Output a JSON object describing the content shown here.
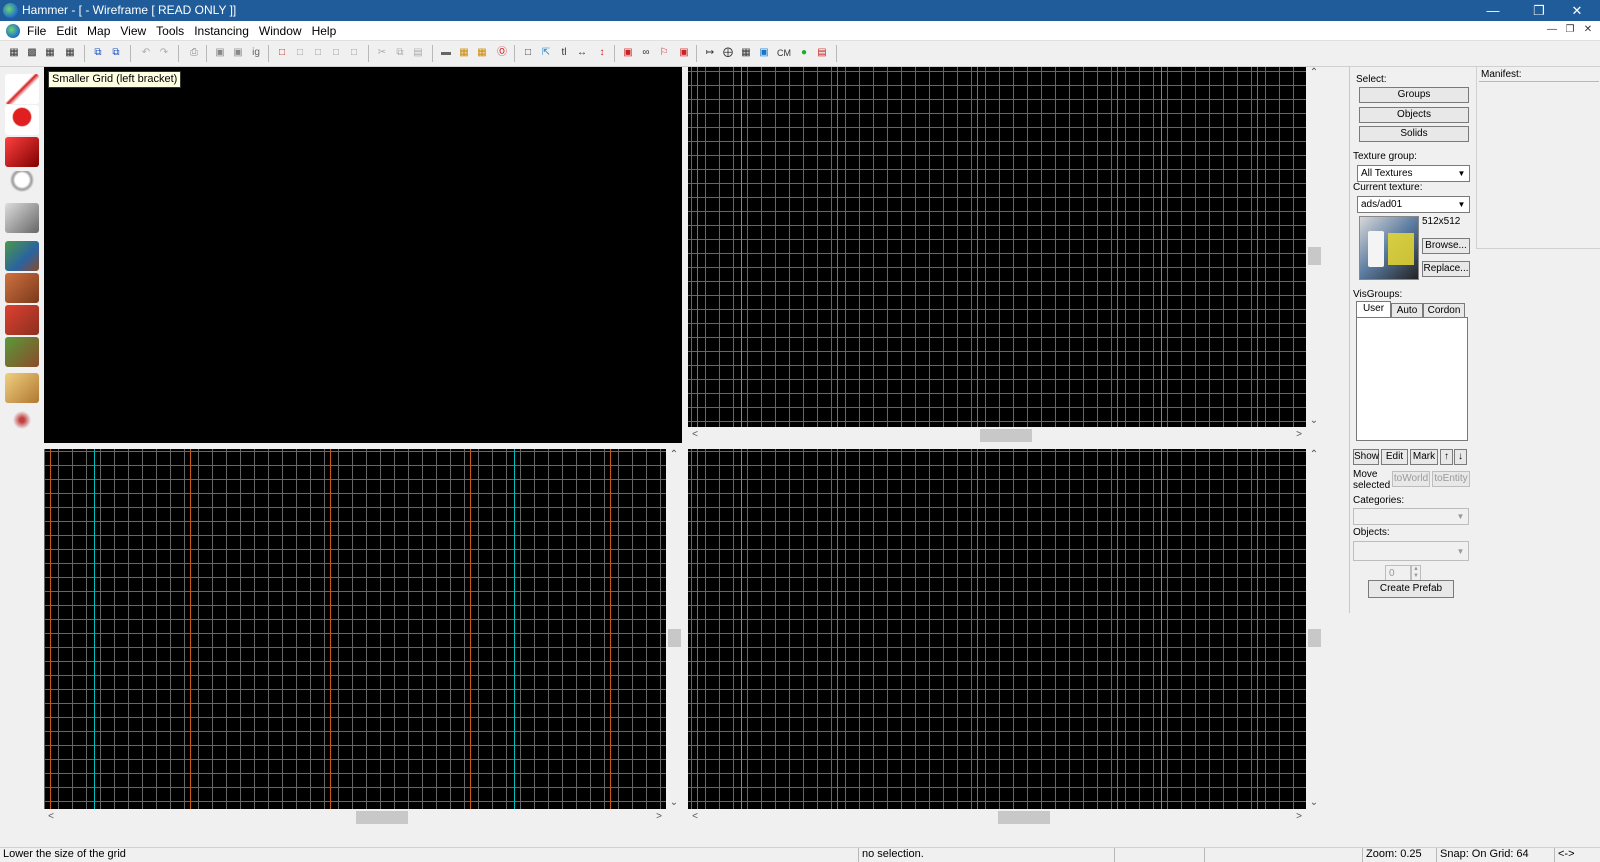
{
  "window": {
    "title": "Hammer - [ - Wireframe [ READ ONLY ]]"
  },
  "menu": [
    "File",
    "Edit",
    "Map",
    "View",
    "Tools",
    "Instancing",
    "Window",
    "Help"
  ],
  "tooltip": "Smaller Grid (left bracket)",
  "toolbar": {
    "cm_label": "CM"
  },
  "select_panel": {
    "label": "Select:",
    "groups": "Groups",
    "objects": "Objects",
    "solids": "Solids"
  },
  "texture_panel": {
    "group_label": "Texture group:",
    "group_value": "All Textures",
    "current_label": "Current texture:",
    "current_value": "ads/ad01",
    "size": "512x512",
    "browse": "Browse...",
    "replace": "Replace..."
  },
  "visgroups": {
    "label": "VisGroups:",
    "tabs": [
      "User",
      "Auto",
      "Cordon"
    ],
    "show": "Show",
    "edit": "Edit",
    "mark": "Mark"
  },
  "move_selected": {
    "label": "Move selected",
    "to_world": "toWorld",
    "to_entity": "toEntity"
  },
  "prefab": {
    "categories_label": "Categories:",
    "objects_label": "Objects:",
    "count_value": "0",
    "create": "Create Prefab"
  },
  "manifest": {
    "label": "Manifest:"
  },
  "statusbar": {
    "help": "Lower the size of the grid",
    "selection": "no selection.",
    "zoom": "Zoom: 0.25",
    "snap": "Snap: On Grid: 64",
    "extra": "<->"
  }
}
